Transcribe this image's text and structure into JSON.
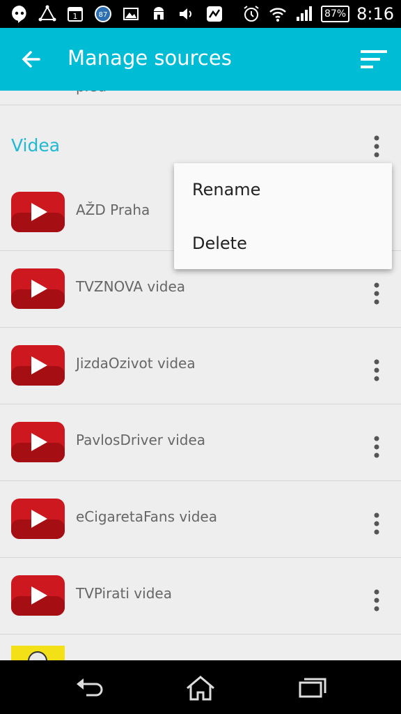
{
  "status_bar": {
    "time": "8:16",
    "battery": "87%",
    "notification_badge": "87",
    "calendar_day": "1"
  },
  "app_bar": {
    "title": "Manage sources"
  },
  "list": {
    "top_partial_label": "prsu",
    "section_title": "Videa",
    "items": [
      {
        "label": "AŽD Praha"
      },
      {
        "label": "TVZNOVA videa"
      },
      {
        "label": "JizdaOzivot videa"
      },
      {
        "label": "PavlosDriver videa"
      },
      {
        "label": "eCigaretaFans videa"
      },
      {
        "label": "TVPirati videa"
      }
    ]
  },
  "popup_menu": {
    "rename": "Rename",
    "delete": "Delete"
  },
  "colors": {
    "accent": "#00bcd4",
    "youtube_red": "#cc181e"
  }
}
